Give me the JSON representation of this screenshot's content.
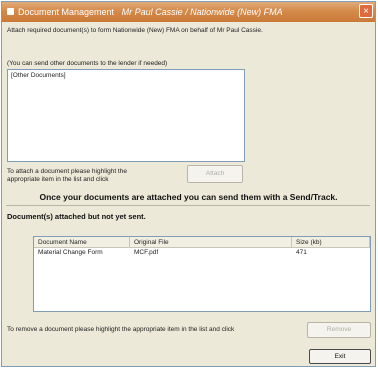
{
  "window": {
    "title_app": "Document Management",
    "title_context": "Mr Paul Cassie / Nationwide (New) FMA",
    "close_label": "×"
  },
  "intro_text": "Attach required document(s) to form Nationwide (New) FMA on behalf of Mr Paul Cassie.",
  "other_docs": {
    "caption": "(You can send other documents to the lender if needed)",
    "items": [
      "[Other Documents]"
    ]
  },
  "attach": {
    "instruction_line1": "To attach a document please highlight the",
    "instruction_line2": "appropriate item in the list and click",
    "button_label": "Attach"
  },
  "send_note": "Once your documents are attached you can send them with a Send/Track.",
  "attached_section": {
    "title": "Document(s) attached but not yet sent.",
    "columns": [
      "Document Name",
      "Original File",
      "Size (kb)"
    ],
    "rows": [
      [
        "Material Change Form",
        "MCF.pdf",
        "471"
      ]
    ]
  },
  "remove": {
    "instruction": "To remove a document please highlight the appropriate item in the list and click",
    "button_label": "Remove"
  },
  "exit_label": "Exit"
}
